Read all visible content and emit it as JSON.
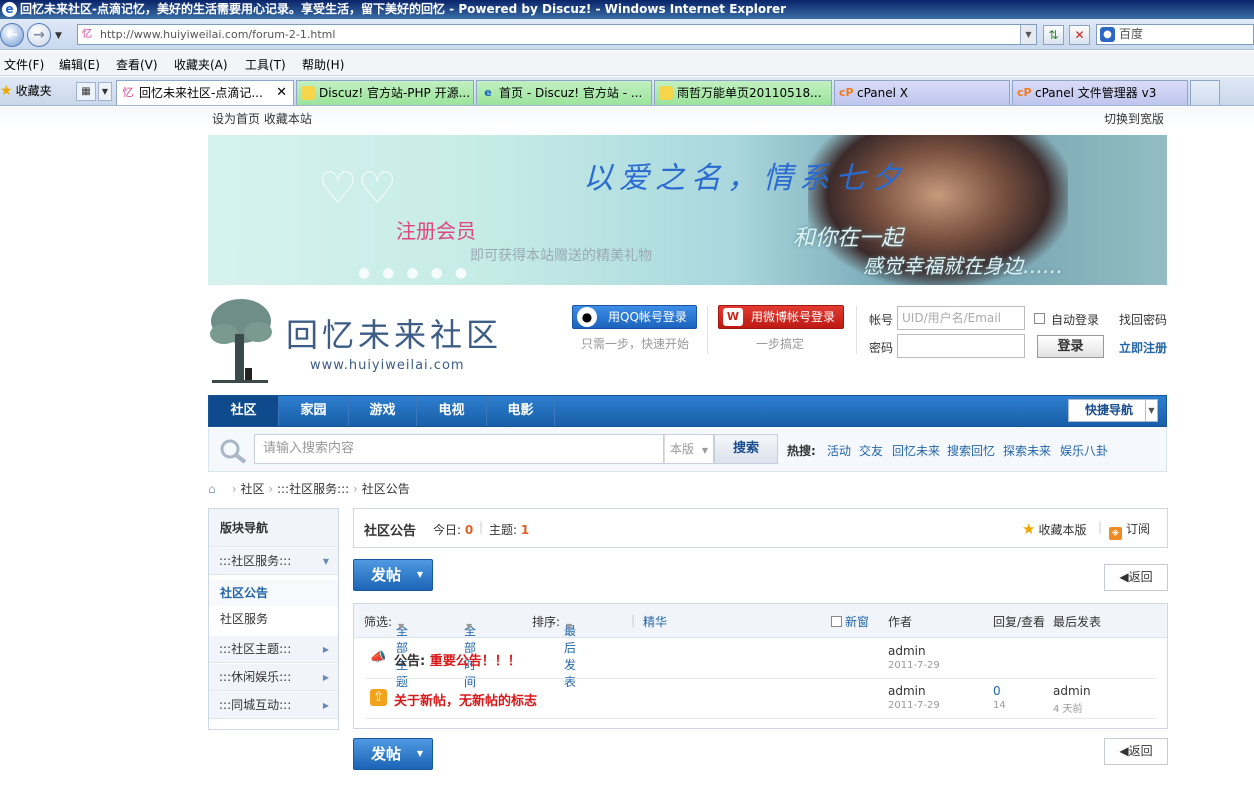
{
  "window": {
    "title": "回忆未来社区-点滴记忆，美好的生活需要用心记录。享受生活，留下美好的回忆 - Powered by Discuz! - Windows Internet Explorer"
  },
  "address": {
    "url": "http://www.huiyiweilai.com/forum-2-1.html",
    "search_engine": "百度"
  },
  "menu": [
    "文件(F)",
    "编辑(E)",
    "查看(V)",
    "收藏夹(A)",
    "工具(T)",
    "帮助(H)"
  ],
  "tabs": {
    "favorites": "收藏夹",
    "items": [
      {
        "label": "回忆未来社区-点滴记...",
        "active": true
      },
      {
        "label": "Discuz! 官方站-PHP 开源..."
      },
      {
        "label": "首页 - Discuz! 官方站 - ..."
      },
      {
        "label": "雨哲万能单页20110518..."
      },
      {
        "label": "cPanel X"
      },
      {
        "label": "cPanel 文件管理器 v3"
      }
    ]
  },
  "topbar": {
    "left": "设为首页  收藏本站",
    "right": "切换到宽版"
  },
  "banner": {
    "slogan": "以爱之名，情系七夕",
    "register": "注册会员",
    "gift": "即可获得本站赠送的精美礼物",
    "line1": "和你在一起",
    "line2": "感觉幸福就在身边……"
  },
  "header": {
    "logo_text": "回忆未来社区",
    "logo_url": "www.huiyiweilai.com",
    "qq_login": "用QQ帐号登录",
    "qq_note": "只需一步，快速开始",
    "weibo_login": "用微博帐号登录",
    "weibo_note": "一步搞定",
    "account_label": "帐号",
    "account_placeholder": "UID/用户名/Email",
    "auto_login": "自动登录",
    "find_password": "找回密码",
    "password_label": "密码",
    "login_button": "登录",
    "register_now": "立即注册"
  },
  "nav": {
    "items": [
      "社区",
      "家园",
      "游戏",
      "电视",
      "电影"
    ],
    "quick_nav": "快捷导航"
  },
  "search": {
    "placeholder": "请输入搜索内容",
    "scope": "本版",
    "button": "搜索",
    "hot_label": "热搜:",
    "hot": [
      "活动",
      "交友",
      "回忆未来",
      "搜索回忆",
      "探索未来",
      "娱乐八卦"
    ]
  },
  "breadcrumb": [
    "社区",
    ":::社区服务:::",
    "社区公告"
  ],
  "sidebar": {
    "title": "版块导航",
    "group1": ":::社区服务:::",
    "items": [
      "社区公告",
      "社区服务"
    ],
    "groups": [
      ":::社区主题:::",
      ":::休闲娱乐:::",
      ":::同城互动:::"
    ]
  },
  "forum": {
    "name": "社区公告",
    "today_label": "今日:",
    "today": "0",
    "threads_label": "主题:",
    "threads": "1",
    "favorite": "收藏本版",
    "subscribe": "订阅"
  },
  "actions": {
    "post": "发帖",
    "back": "返回"
  },
  "threadlist": {
    "filter_label": "筛选:",
    "all_threads": "全部主题",
    "all_time": "全部时间",
    "sort_label": "排序:",
    "latest": "最后发表",
    "digest": "精华",
    "new_window": "新窗",
    "col_author": "作者",
    "col_replies": "回复/查看",
    "col_last": "最后发表",
    "rows": [
      {
        "prefix": "公告:",
        "title": "重要公告！！！",
        "author": "admin",
        "date": "2011-7-29",
        "replies": "",
        "views": "",
        "last_author": "",
        "last_time": ""
      },
      {
        "prefix": "",
        "title": "关于新帖，无新帖的标志",
        "author": "admin",
        "date": "2011-7-29",
        "replies": "0",
        "views": "14",
        "last_author": "admin",
        "last_time": "4 天前"
      }
    ]
  }
}
